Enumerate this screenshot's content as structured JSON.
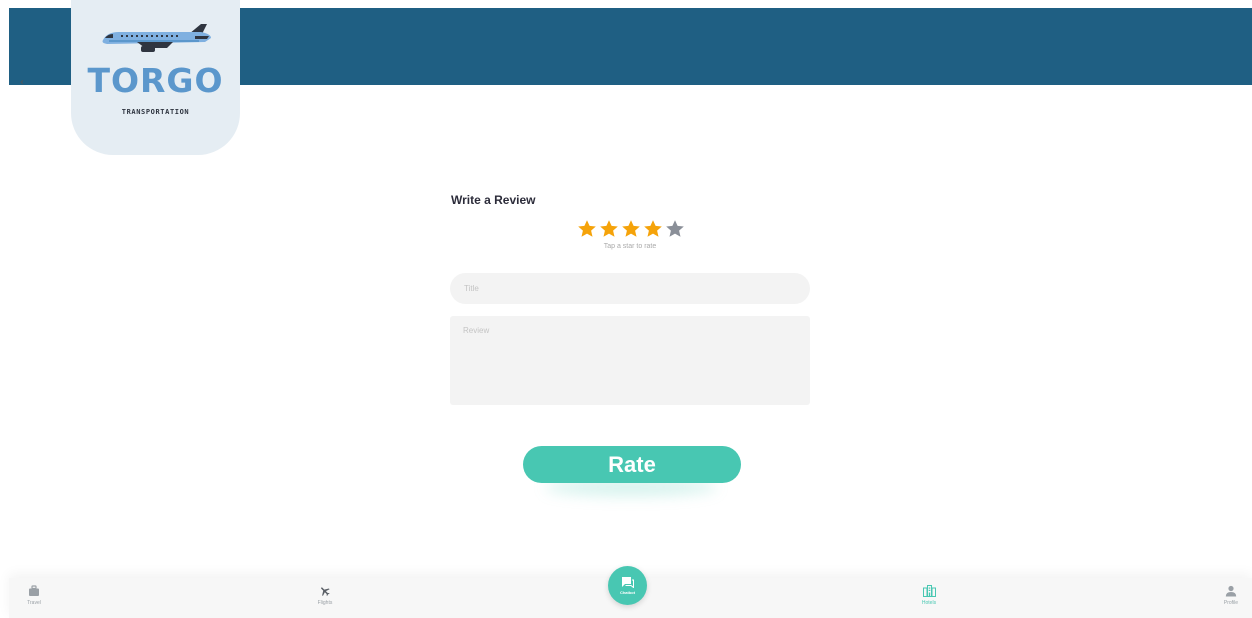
{
  "header": {
    "logo_title": "TORGO",
    "logo_subtitle": "TRANSPORTATION",
    "back_glyph": "‹"
  },
  "review": {
    "heading": "Write a Review",
    "rating": 4,
    "max_rating": 5,
    "hint": "Tap a star to rate",
    "title_placeholder": "Title",
    "title_value": "",
    "review_placeholder": "Review",
    "review_value": "",
    "submit_label": "Rate"
  },
  "nav": {
    "items": [
      {
        "label": "Travel",
        "icon": "briefcase-icon",
        "active": false
      },
      {
        "label": "Flights",
        "icon": "plane-icon",
        "active": false
      },
      {
        "label": "Hotels",
        "icon": "hotel-icon",
        "active": true
      },
      {
        "label": "Profile",
        "icon": "user-icon",
        "active": false
      }
    ],
    "fab": {
      "label": "Chatbot",
      "icon": "chat-icon"
    }
  },
  "colors": {
    "header": "#1f5f83",
    "accent": "#48c7b2",
    "star_filled": "#f5a30a",
    "star_empty": "#8a8f98",
    "logo_text": "#5b97cc",
    "logo_bg": "#e5edf3"
  }
}
